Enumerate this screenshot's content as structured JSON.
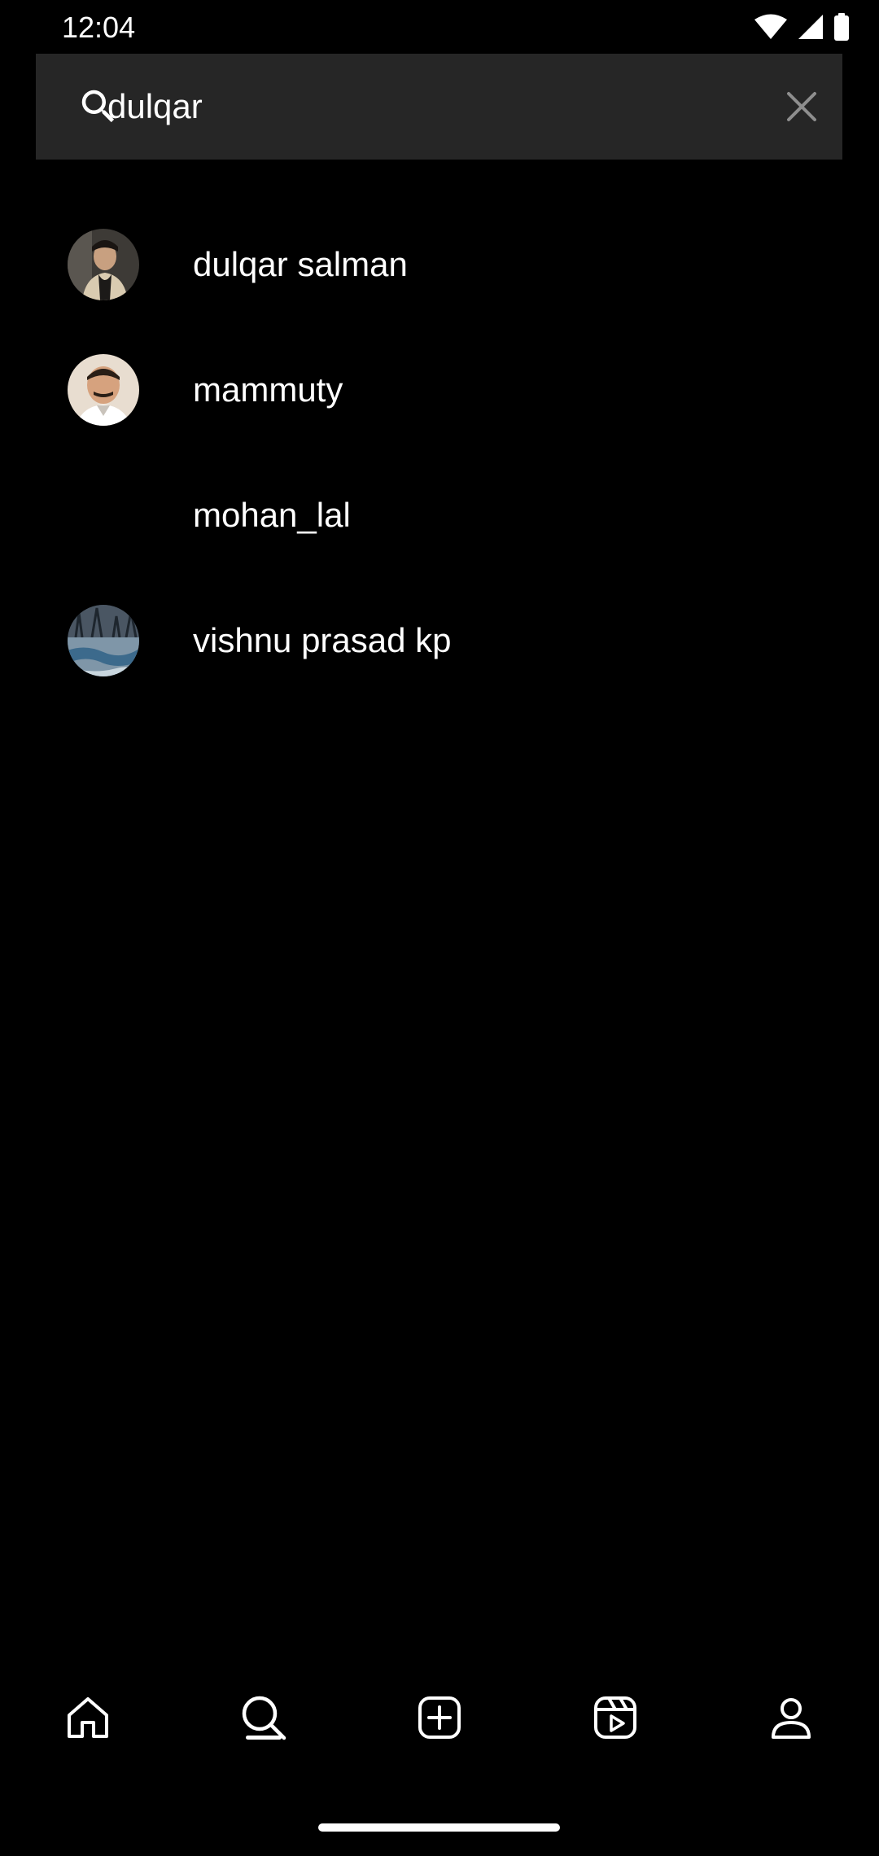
{
  "status_bar": {
    "time": "12:04",
    "icons": [
      "wifi-icon",
      "cellular-signal-icon",
      "battery-icon"
    ]
  },
  "search": {
    "value": "dulqar",
    "icon": "search-icon",
    "clear_icon": "close-icon"
  },
  "results": [
    {
      "label": "dulqar salman",
      "avatar": "profile-photo"
    },
    {
      "label": "mammuty",
      "avatar": "profile-photo"
    },
    {
      "label": "mohan_lal",
      "avatar": "none"
    },
    {
      "label": "vishnu prasad kp",
      "avatar": "profile-photo"
    }
  ],
  "bottom_nav": {
    "items": [
      {
        "icon": "home-icon"
      },
      {
        "icon": "search-icon",
        "active": true
      },
      {
        "icon": "add-post-icon"
      },
      {
        "icon": "reels-icon"
      },
      {
        "icon": "profile-icon"
      }
    ]
  },
  "colors": {
    "background": "#000000",
    "search_bar": "#262626",
    "text": "#ffffff",
    "clear_icon": "#8e8e8e"
  }
}
